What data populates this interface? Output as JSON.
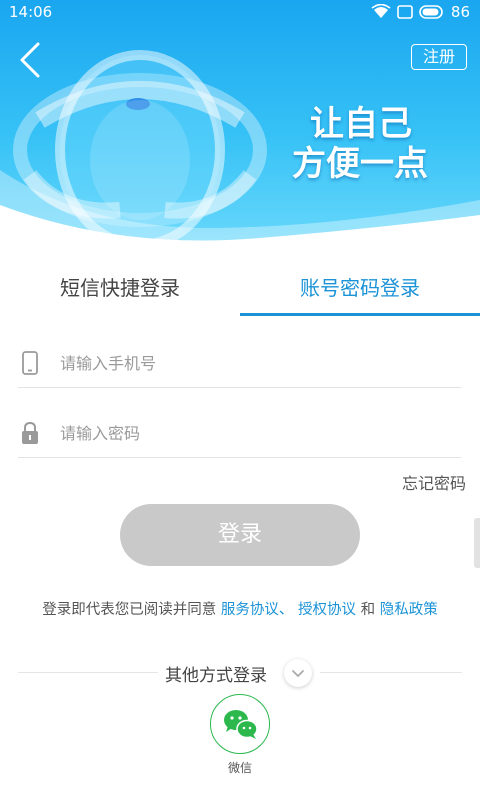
{
  "status_bar": {
    "time": "14:06",
    "battery": "86"
  },
  "header": {
    "register_label": "注册"
  },
  "banner": {
    "slogan_line1": "让自己",
    "slogan_line2": "方便一点"
  },
  "tabs": [
    {
      "label": "短信快捷登录",
      "active": false
    },
    {
      "label": "账号密码登录",
      "active": true
    }
  ],
  "form": {
    "phone_placeholder": "请输入手机号",
    "password_placeholder": "请输入密码",
    "forgot_label": "忘记密码",
    "login_label": "登录"
  },
  "agreement": {
    "prefix": "登录即代表您已阅读并同意",
    "service_link": "服务协议、",
    "auth_link": "授权协议",
    "and": "和",
    "privacy_link": "隐私政策"
  },
  "other_login": {
    "label": "其他方式登录",
    "wechat_label": "微信"
  },
  "colors": {
    "accent": "#1b93d6",
    "wechat_green": "#2db84e",
    "login_disabled": "#c9c9c9",
    "hero_blue": "#1aa6f0"
  }
}
